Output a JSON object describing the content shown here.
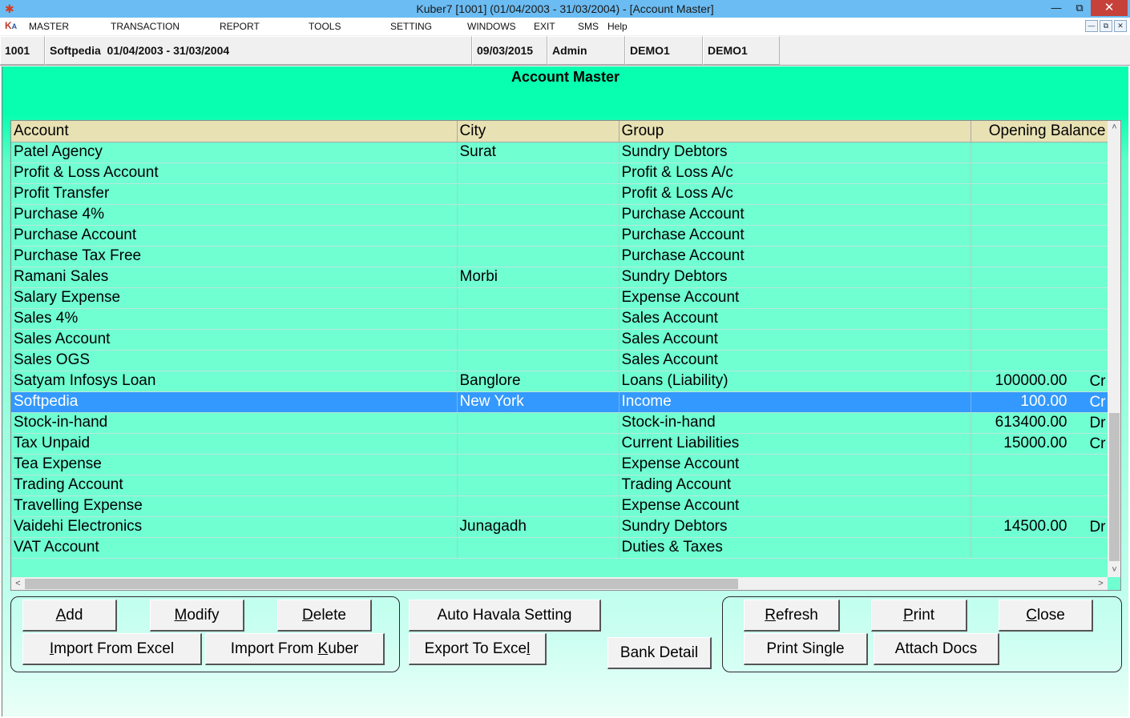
{
  "window": {
    "title": "Kuber7 [1001] (01/04/2003 - 31/03/2004) - [Account Master]",
    "min_glyph": "—",
    "max_glyph": "⧉",
    "close_glyph": "✕"
  },
  "menu": {
    "logo_k": "K",
    "logo_a": "A",
    "items": [
      "MASTER",
      "TRANSACTION",
      "REPORT",
      "TOOLS",
      "SETTING",
      "WINDOWS",
      "EXIT",
      "SMS",
      "Help"
    ]
  },
  "info": {
    "company_code": "1001",
    "company": "Softpedia  01/04/2003 - 31/03/2004",
    "date": "09/03/2015",
    "user": "Admin",
    "db1": "DEMO1",
    "db2": "DEMO1"
  },
  "form": {
    "title": "Account Master"
  },
  "grid": {
    "columns": [
      "Account",
      "City",
      "Group",
      "Opening Balance"
    ],
    "rows": [
      {
        "account": "Patel Agency",
        "city": "Surat",
        "group": "Sundry Debtors",
        "amount": "",
        "dc": ""
      },
      {
        "account": "Profit & Loss Account",
        "city": "",
        "group": "Profit & Loss A/c",
        "amount": "",
        "dc": ""
      },
      {
        "account": "Profit Transfer",
        "city": "",
        "group": "Profit & Loss A/c",
        "amount": "",
        "dc": ""
      },
      {
        "account": "Purchase 4%",
        "city": "",
        "group": "Purchase Account",
        "amount": "",
        "dc": ""
      },
      {
        "account": "Purchase Account",
        "city": "",
        "group": "Purchase Account",
        "amount": "",
        "dc": ""
      },
      {
        "account": "Purchase Tax Free",
        "city": "",
        "group": "Purchase Account",
        "amount": "",
        "dc": ""
      },
      {
        "account": "Ramani Sales",
        "city": "Morbi",
        "group": "Sundry Debtors",
        "amount": "",
        "dc": ""
      },
      {
        "account": "Salary Expense",
        "city": "",
        "group": "Expense Account",
        "amount": "",
        "dc": ""
      },
      {
        "account": "Sales 4%",
        "city": "",
        "group": "Sales Account",
        "amount": "",
        "dc": ""
      },
      {
        "account": "Sales Account",
        "city": "",
        "group": "Sales Account",
        "amount": "",
        "dc": ""
      },
      {
        "account": "Sales OGS",
        "city": "",
        "group": "Sales Account",
        "amount": "",
        "dc": ""
      },
      {
        "account": "Satyam Infosys Loan",
        "city": "Banglore",
        "group": "Loans (Liability)",
        "amount": "100000.00",
        "dc": "Cr"
      },
      {
        "account": "Softpedia",
        "city": "New York",
        "group": "Income",
        "amount": "100.00",
        "dc": "Cr",
        "selected": true
      },
      {
        "account": "Stock-in-hand",
        "city": "",
        "group": "Stock-in-hand",
        "amount": "613400.00",
        "dc": "Dr"
      },
      {
        "account": "Tax Unpaid",
        "city": "",
        "group": "Current Liabilities",
        "amount": "15000.00",
        "dc": "Cr"
      },
      {
        "account": "Tea Expense",
        "city": "",
        "group": "Expense Account",
        "amount": "",
        "dc": ""
      },
      {
        "account": "Trading Account",
        "city": "",
        "group": "Trading Account",
        "amount": "",
        "dc": ""
      },
      {
        "account": "Travelling Expense",
        "city": "",
        "group": "Expense Account",
        "amount": "",
        "dc": ""
      },
      {
        "account": "Vaidehi Electronics",
        "city": "Junagadh",
        "group": "Sundry Debtors",
        "amount": "14500.00",
        "dc": "Dr"
      },
      {
        "account": "VAT Account",
        "city": "",
        "group": "Duties & Taxes",
        "amount": "",
        "dc": ""
      }
    ]
  },
  "buttons": {
    "add": {
      "pre": "",
      "key": "A",
      "post": "dd"
    },
    "modify": {
      "pre": "",
      "key": "M",
      "post": "odify"
    },
    "delete": {
      "pre": "",
      "key": "D",
      "post": "elete"
    },
    "import_excel": {
      "pre": "",
      "key": "I",
      "post": "mport From Excel"
    },
    "import_kuber": {
      "pre": "Import From ",
      "key": "K",
      "post": "uber"
    },
    "auto_havala": {
      "pre": "Auto Havala Setting",
      "key": "",
      "post": ""
    },
    "export_excel": {
      "pre": "Export To Exce",
      "key": "l",
      "post": ""
    },
    "bank_detail": {
      "pre": "Bank Detail",
      "key": "",
      "post": ""
    },
    "refresh": {
      "pre": "",
      "key": "R",
      "post": "efresh"
    },
    "print": {
      "pre": "",
      "key": "P",
      "post": "rint"
    },
    "close": {
      "pre": "",
      "key": "C",
      "post": "lose"
    },
    "print_single": {
      "pre": "Print Single",
      "key": "",
      "post": ""
    },
    "attach_docs": {
      "pre": "Attach Docs",
      "key": "",
      "post": ""
    }
  },
  "scroll": {
    "up": "˄",
    "down": "˅",
    "left": "<",
    "right": ">"
  },
  "colors": {
    "form_bg": "#08ffb0",
    "grid_row": "#70ffd0",
    "header": "#e8e1b4",
    "selected": "#3399ff",
    "titlebar": "#6bbcf2",
    "close": "#c7413b"
  }
}
